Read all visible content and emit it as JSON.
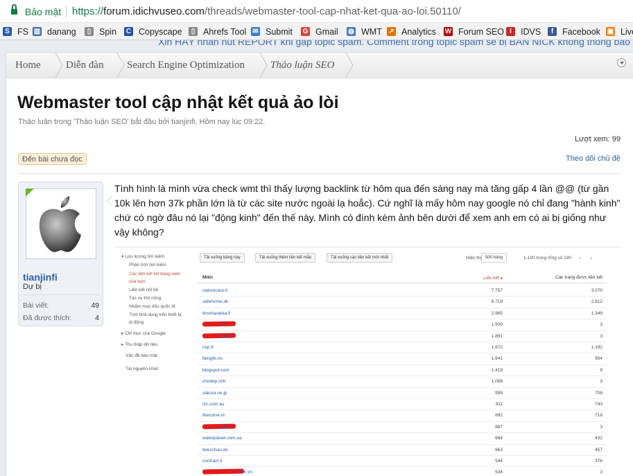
{
  "browser": {
    "secure_label": "Bảo mật",
    "url_scheme": "https://",
    "url_host": "forum.idichvuseo.com",
    "url_path": "/threads/webmaster-tool-cap-nhat-ket-qua-ao-loi.50110/",
    "bookmarks": [
      {
        "label": "FS",
        "icon": "fs-icon"
      },
      {
        "label": "danang",
        "icon": "chart-icon"
      },
      {
        "label": "Spin",
        "icon": "page-icon"
      },
      {
        "label": "Copyscape",
        "icon": "copyscape-icon"
      },
      {
        "label": "Ahrefs Tool",
        "icon": "page-icon"
      },
      {
        "label": "Submit",
        "icon": "submit-icon"
      },
      {
        "label": "Gmail",
        "icon": "google-icon"
      },
      {
        "label": "WMT",
        "icon": "globe-icon"
      },
      {
        "label": "Analytics",
        "icon": "analytics-icon"
      },
      {
        "label": "Forum SEO",
        "icon": "w-icon"
      },
      {
        "label": "IDVS",
        "icon": "idvs-icon"
      },
      {
        "label": "Facebook",
        "icon": "facebook-icon"
      },
      {
        "label": "Live",
        "icon": "live-icon"
      }
    ]
  },
  "ticker": "Xin HÃY nhấn nút REPORT khi gặp topic spam. Comment trong topic spam sẽ bị BAN NICK không thông báo",
  "breadcrumbs": [
    "Home",
    "Diễn đàn",
    "Search Engine Optimization",
    "Thảo luận SEO"
  ],
  "thread": {
    "title": "Webmaster tool cập nhật kết quả ảo lòi",
    "meta": "Thảo luận trong 'Thảo luận SEO' bắt đầu bởi tianjinfi, Hôm nay lúc 09:22.",
    "views": "Lượt xem: 99",
    "unread_label": "Đến bài chưa đọc",
    "follow_label": "Theo dõi chủ đề"
  },
  "user": {
    "name": "tianjinfi",
    "title": "Dự bị",
    "posts_label": "Bài viết:",
    "posts": "49",
    "likes_label": "Đã được thích:",
    "likes": "4"
  },
  "post": {
    "text": "Tình hình là mình vừa check wmt thì thấy lượng backlink từ hôm qua đến sáng nay mà tăng gấp 4 lần @@ (từ gần 10k lên hơn 37k phần lớn là từ các site nước ngoài lạ hoắc). Cứ nghĩ là mấy hôm nay google nó chỉ đang \"hành kinh\" chứ có ngờ đâu nó lại \"động kinh\" đến thế này. Mình có đính kèm ảnh bên dưới để xem anh em có ai bị giống như vậy không?"
  },
  "screenshot": {
    "sidebar": [
      {
        "label": "▾ Lưu lượng tìm kiếm",
        "red": false
      },
      {
        "label": "Phân tích tìm kiếm",
        "red": false
      },
      {
        "label": "Các liên kết tới trang web",
        "red": true
      },
      {
        "label": "của bạn",
        "red": true
      },
      {
        "label": "Liên kết nội bộ",
        "red": false
      },
      {
        "label": "Tác vụ thủ công",
        "red": false
      },
      {
        "label": "Nhắm mục tiêu quốc tế",
        "red": false
      },
      {
        "label": "Tính khả dụng trên thiết bị",
        "red": false
      },
      {
        "label": "di động",
        "red": false
      },
      {
        "label": "▸ Chỉ mục của Google",
        "red": false
      },
      {
        "label": "▸ Thu thập dữ liệu",
        "red": false
      },
      {
        "label": "Vấn đề bảo mật",
        "red": false
      },
      {
        "label": "Tài nguyên khác",
        "red": false
      }
    ],
    "buttons": [
      "Tải xuống bảng này",
      "Tải xuống thêm liên kết mẫu",
      "Tải xuống các liên kết mới nhất"
    ],
    "show_label": "Hiển thị",
    "show_value": "500 hàng",
    "range": "1-190 trong tổng số 190",
    "headers": {
      "domain": "Miền",
      "links": "Liên kết ▴",
      "pages": "Các trang được liên kết"
    },
    "rows": [
      {
        "domain": "naturecare.it",
        "links": "7.757",
        "pages": "3.070"
      },
      {
        "domain": "safehome.dk",
        "links": "6.719",
        "pages": "2.812"
      },
      {
        "domain": "timoharakka.fi",
        "links": "2.965",
        "pages": "1.349"
      },
      {
        "domain": ".vn",
        "links": "1.939",
        "pages": "3",
        "redacted": true
      },
      {
        "domain": ".com",
        "links": "1.891",
        "pages": "3",
        "redacted": true
      },
      {
        "domain": "nvp.fr",
        "links": "1.672",
        "pages": "1.192"
      },
      {
        "domain": "fatogfe.no",
        "links": "1.641",
        "pages": "954"
      },
      {
        "domain": "blogspot.com",
        "links": "1.419",
        "pages": "9"
      },
      {
        "domain": "chodep.info",
        "links": "1.098",
        "pages": "3"
      },
      {
        "domain": "sakura.ne.jp",
        "links": "998",
        "pages": "708"
      },
      {
        "domain": "i2c.com.au",
        "links": "911",
        "pages": "743"
      },
      {
        "domain": "thecurve.nl",
        "links": "892",
        "pages": "718"
      },
      {
        "domain": ".com",
        "links": "687",
        "pages": "3",
        "redacted": true
      },
      {
        "domain": "waterplanet.com.ua",
        "links": "684",
        "pages": "432"
      },
      {
        "domain": "teleschau.de",
        "links": "663",
        "pages": "457"
      },
      {
        "domain": "contram.it",
        "links": "544",
        "pages": "376"
      },
      {
        "domain": "com.vn",
        "links": "534",
        "pages": "3",
        "redacted": true
      }
    ]
  }
}
